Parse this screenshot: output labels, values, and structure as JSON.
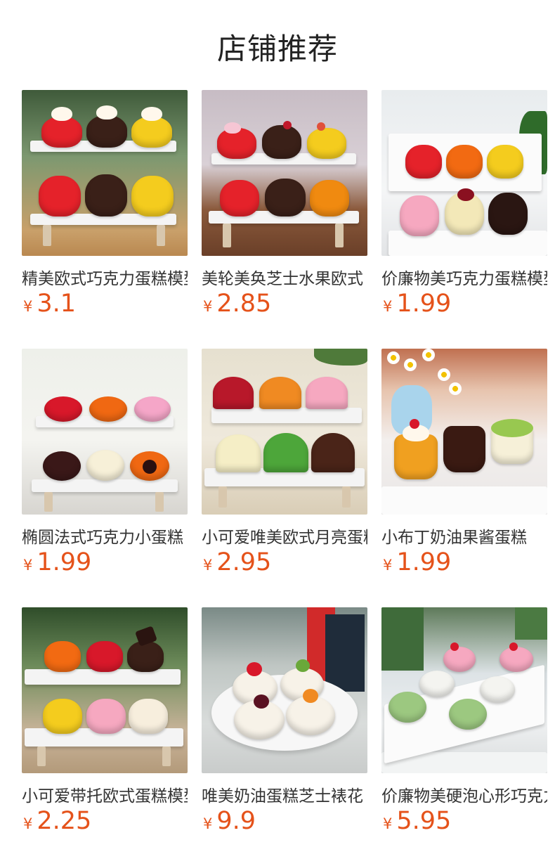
{
  "header": {
    "title": "店铺推荐"
  },
  "products": [
    {
      "name": "精美欧式巧克力蛋糕模型",
      "currency": "¥",
      "price": "3.1"
    },
    {
      "name": "美轮美奂芝士水果欧式",
      "currency": "¥",
      "price": "2.85"
    },
    {
      "name": "价廉物美巧克力蛋糕模型",
      "currency": "¥",
      "price": "1.99"
    },
    {
      "name": "椭圆法式巧克力小蛋糕",
      "currency": "¥",
      "price": "1.99"
    },
    {
      "name": "小可爱唯美欧式月亮蛋糕",
      "currency": "¥",
      "price": "2.95"
    },
    {
      "name": "小布丁奶油果酱蛋糕",
      "currency": "¥",
      "price": "1.99"
    },
    {
      "name": "小可爱带托欧式蛋糕模型",
      "currency": "¥",
      "price": "2.25"
    },
    {
      "name": "唯美奶油蛋糕芝士裱花",
      "currency": "¥",
      "price": "9.9"
    },
    {
      "name": "价廉物美硬泡心形巧克力",
      "currency": "¥",
      "price": "5.95"
    }
  ],
  "colors": {
    "price": "#e5521a",
    "title": "#222222",
    "name": "#333333"
  }
}
